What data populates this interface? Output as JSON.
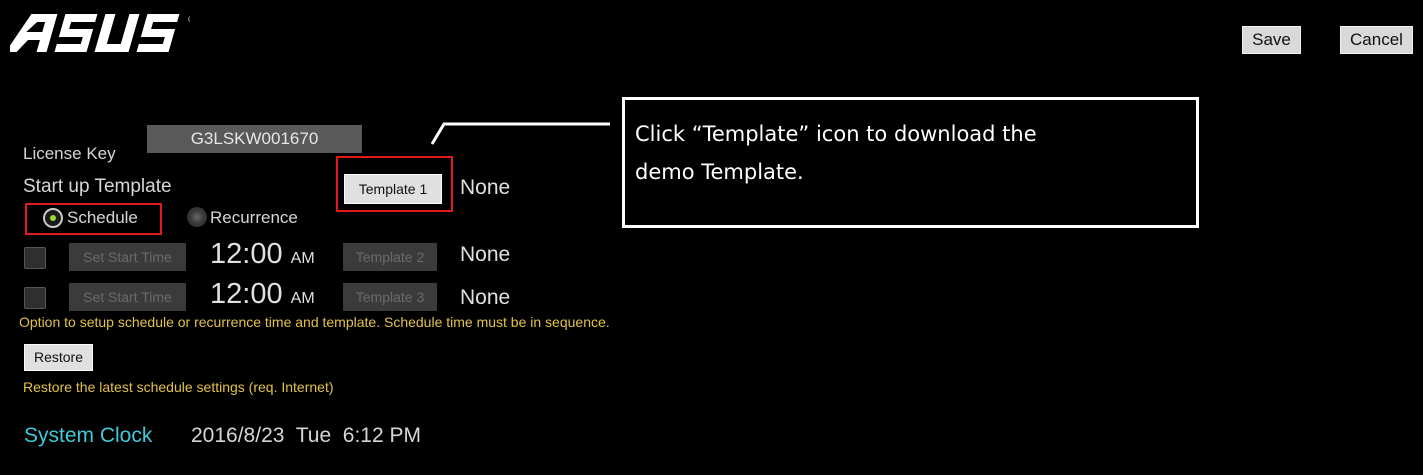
{
  "header": {
    "logo_text": "ASUS",
    "save_label": "Save",
    "cancel_label": "Cancel"
  },
  "license": {
    "label": "License Key",
    "value": "G3LSKW001670"
  },
  "startup": {
    "label": "Start up Template",
    "template_button": "Template 1",
    "template_value": "None"
  },
  "mode": {
    "options": [
      {
        "label": "Schedule",
        "selected": true
      },
      {
        "label": "Recurrence",
        "selected": false
      }
    ]
  },
  "schedule_rows": [
    {
      "checked": false,
      "set_time_label": "Set Start Time",
      "time": "12:00",
      "ampm": "AM",
      "template_button": "Template 2",
      "template_value": "None"
    },
    {
      "checked": false,
      "set_time_label": "Set Start Time",
      "time": "12:00",
      "ampm": "AM",
      "template_button": "Template 3",
      "template_value": "None"
    }
  ],
  "schedule_hint": "Option to setup schedule or recurrence time and template. Schedule time must be in sequence.",
  "restore": {
    "button_label": "Restore",
    "hint": "Restore the latest schedule settings (req. Internet)"
  },
  "system_clock": {
    "label": "System Clock",
    "value": "2016/8/23  Tue  6:12 PM"
  },
  "callout": {
    "line1": "Click “Template” icon to download the",
    "line2": "demo Template."
  },
  "colors": {
    "background": "#000000",
    "hint_text": "#e3c24a",
    "clock_label": "#41c8d6",
    "highlight_frame": "#e01b1b",
    "radio_selected": "#9bd92e"
  }
}
